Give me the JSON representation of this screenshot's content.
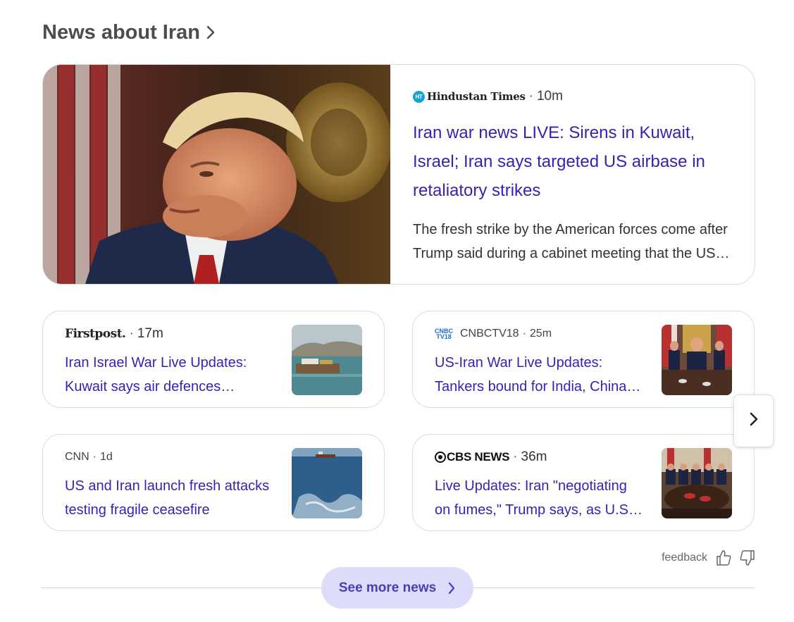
{
  "section": {
    "title": "News about Iran"
  },
  "featured": {
    "source": "Hindustan Times",
    "source_badge": "HT",
    "time": "10m",
    "headline": "Iran war news LIVE: Sirens in Kuwait, Israel; Iran says targeted US airbase in retaliatory strikes",
    "snippet": "The fresh strike by the American forces come after Trump said during a cabinet meeting that the US is winning the war against Iran."
  },
  "cards": [
    {
      "source": "Firstpost.",
      "time": "17m",
      "title": "Iran Israel War Live Updates: Kuwait says air defences intercepted missiles",
      "image": "ship-icon"
    },
    {
      "source": "CNBCTV18",
      "source_logo_top": "CNBC",
      "source_logo_bottom": "TV18",
      "time": "25m",
      "title": "US-Iran War Live Updates: Tankers bound for India, China diverted",
      "image": "cabinet-meeting-image"
    },
    {
      "source": "CNN",
      "time": "1d",
      "title": "US and Iran launch fresh attacks testing fragile ceasefire",
      "image": "sea-tanker-image"
    },
    {
      "source": "CBS NEWS",
      "time": "36m",
      "title": "Live Updates: Iran \"negotiating on fumes,\" Trump says, as U.S. strikes continue",
      "image": "cabinet-table-image"
    }
  ],
  "feedback": {
    "label": "feedback"
  },
  "see_more": {
    "label": "See more news"
  },
  "colors": {
    "headline": "#3a1fb0",
    "button_bg": "#dddcfb",
    "button_text": "#4a3db5"
  }
}
